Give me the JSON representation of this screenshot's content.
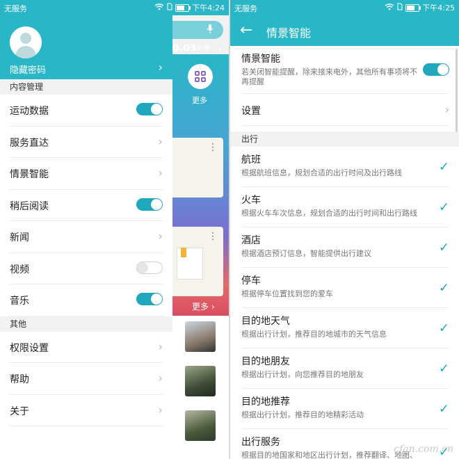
{
  "left": {
    "status": {
      "carrier": "无服务",
      "time": "下午4:24"
    },
    "background": {
      "distance": "0.03",
      "distance_unit": "公里",
      "more_icon_label": "更多",
      "more_link": "更多"
    },
    "drawer": {
      "account_name": "隐藏密码",
      "section_content": "内容管理",
      "items_content": [
        {
          "label": "运动数据",
          "control": "toggle",
          "on": true
        },
        {
          "label": "服务直达",
          "control": "chevron"
        },
        {
          "label": "情景智能",
          "control": "chevron"
        },
        {
          "label": "稍后阅读",
          "control": "toggle",
          "on": true
        },
        {
          "label": "新闻",
          "control": "chevron"
        },
        {
          "label": "视频",
          "control": "toggle",
          "on": false
        },
        {
          "label": "音乐",
          "control": "toggle",
          "on": true
        }
      ],
      "section_other": "其他",
      "items_other": [
        {
          "label": "权限设置",
          "control": "chevron"
        },
        {
          "label": "帮助",
          "control": "chevron"
        },
        {
          "label": "关于",
          "control": "chevron"
        }
      ]
    }
  },
  "right": {
    "status": {
      "carrier": "无服务",
      "time": "下午4:25"
    },
    "title": "情景智能",
    "master": {
      "title": "情景智能",
      "subtitle": "若关闭智能提醒，除来接来电外，其他所有事项将不再提醒",
      "on": true
    },
    "settings_label": "设置",
    "section_travel": "出行",
    "travel_items": [
      {
        "title": "航班",
        "subtitle": "根据航班信息，规划合适的出行时间及出行路线",
        "checked": true
      },
      {
        "title": "火车",
        "subtitle": "根据火车车次信息，规划合适的出行时间和出行路线",
        "checked": true
      },
      {
        "title": "酒店",
        "subtitle": "根据酒店预订信息，智能提供出行建议",
        "checked": true
      },
      {
        "title": "停车",
        "subtitle": "根据停车位置找到您的爱车",
        "checked": true
      },
      {
        "title": "目的地天气",
        "subtitle": "根据出行计划，推荐目的地城市的天气信息",
        "checked": true
      },
      {
        "title": "目的地朋友",
        "subtitle": "根据出行计划，向您推荐目的地朋友",
        "checked": true
      },
      {
        "title": "目的地推荐",
        "subtitle": "根据出行计划，推荐目的地精彩活动",
        "checked": true
      },
      {
        "title": "出行服务",
        "subtitle": "根据目的地国家和地区出行计划，推荐翻译、地图、汇率等相关服务",
        "checked": true
      }
    ],
    "watermark": "cfan.com.cn"
  },
  "colors": {
    "accent": "#29b6c6",
    "toggle_on": "#1fa8be"
  }
}
